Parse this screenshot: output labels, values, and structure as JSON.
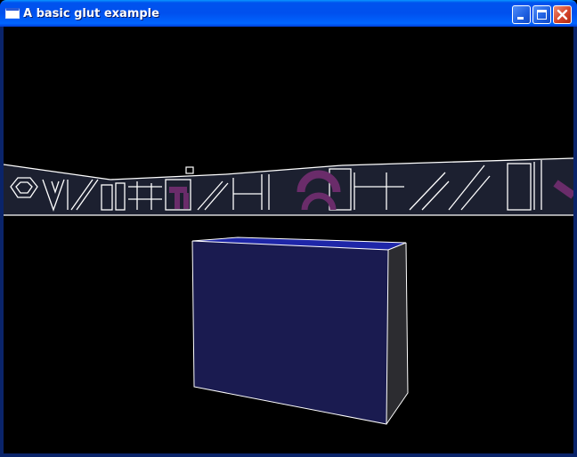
{
  "window": {
    "title": "A basic glut example",
    "titlebar_color": "#0054e3",
    "frame_color": "#0a246a"
  },
  "icons": {
    "app": "window-icon",
    "minimize": "minimize-icon",
    "maximize": "maximize-icon",
    "close": "close-icon"
  },
  "scene": {
    "background_color": "#000000",
    "wall_color": "#1c2030",
    "wall_outline_color": "#ffffff",
    "wall_accent_color": "#6a2c6a",
    "cube_front_color": "#1a1b50",
    "cube_top_color": "#1e26a8",
    "cube_side_color": "#2c2c30",
    "cube_edge_color": "#ffffff"
  }
}
